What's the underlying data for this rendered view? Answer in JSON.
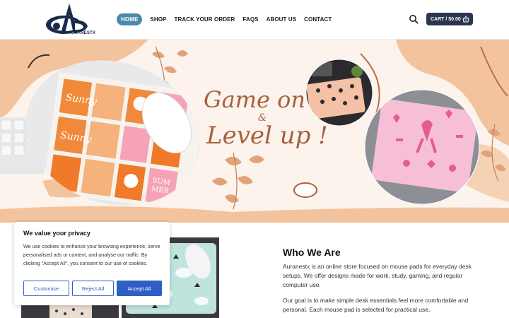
{
  "brand": {
    "name": "AURANESTX"
  },
  "nav": {
    "items": [
      {
        "label": "HOME",
        "active": true
      },
      {
        "label": "SHOP",
        "active": false
      },
      {
        "label": "TRACK YOUR ORDER",
        "active": false
      },
      {
        "label": "FAQS",
        "active": false
      },
      {
        "label": "ABOUT US",
        "active": false
      },
      {
        "label": "CONTACT",
        "active": false
      }
    ]
  },
  "header": {
    "cart_label": "CART / $0.00",
    "search_icon": "search-icon",
    "cart_icon": "basket-icon"
  },
  "hero": {
    "headline_1": "Game on",
    "amp": "&",
    "headline_2": "Level up !"
  },
  "pad_art": {
    "left_words": [
      "Sunny",
      "Sunny"
    ],
    "right_words": [
      "SUM",
      "MER"
    ]
  },
  "about": {
    "title": "Who We Are",
    "p1": "Auranestx is an online store focused on mouse pads for everyday desk setups. We offer designs made for work, study, gaming, and regular computer use.",
    "p2": "Our goal is to make simple desk essentials feel more comfortable and personal. Each mouse pad is selected for practical use,"
  },
  "cookie": {
    "title": "We value your privacy",
    "text": "We use cookies to enhance your browsing experience, serve personalised ads or content, and analyse our traffic. By clicking \"Accept All\", you consent to our use of cookies.",
    "customise": "Customise",
    "reject": "Reject All",
    "accept": "Accept All"
  },
  "colors": {
    "accent": "#4a8aa8",
    "cart_bg": "#2c3550",
    "button_blue": "#2f5fc4",
    "hero_text": "#a8603c",
    "peach": "#f2c39d"
  }
}
